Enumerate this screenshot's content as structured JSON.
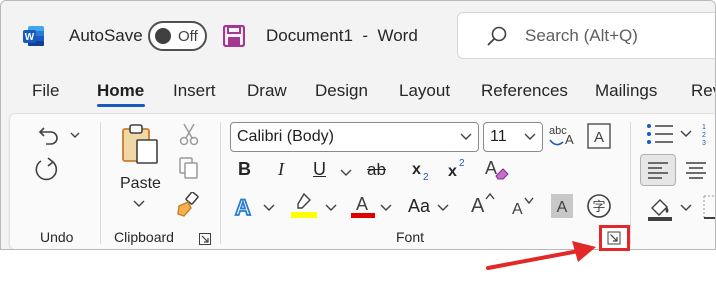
{
  "titlebar": {
    "app_icon": "word-logo",
    "autosave_label": "AutoSave",
    "autosave_state": "Off",
    "save_icon": "save-icon",
    "document_title": "Document1  -  Word",
    "search_placeholder": "Search (Alt+Q)"
  },
  "tabs": [
    {
      "label": "File"
    },
    {
      "label": "Home",
      "active": true
    },
    {
      "label": "Insert"
    },
    {
      "label": "Draw"
    },
    {
      "label": "Design"
    },
    {
      "label": "Layout"
    },
    {
      "label": "References"
    },
    {
      "label": "Mailings"
    },
    {
      "label": "Rev"
    }
  ],
  "ribbon": {
    "undo_group": {
      "label": "Undo"
    },
    "clipboard_group": {
      "label": "Clipboard",
      "paste_label": "Paste"
    },
    "font_group": {
      "label": "Font",
      "font_name": "Calibri (Body)",
      "font_size": "11",
      "change_case_label": "Aa",
      "bold": "B",
      "italic": "I",
      "underline": "U",
      "strikethrough": "ab"
    }
  },
  "colors": {
    "accent": "#185abd",
    "word_blue": "#185abd",
    "highlight_red": "#e22828",
    "highlight_yellow": "#ffff00",
    "font_color_red": "#e00000",
    "save_purple": "#a4378f"
  }
}
